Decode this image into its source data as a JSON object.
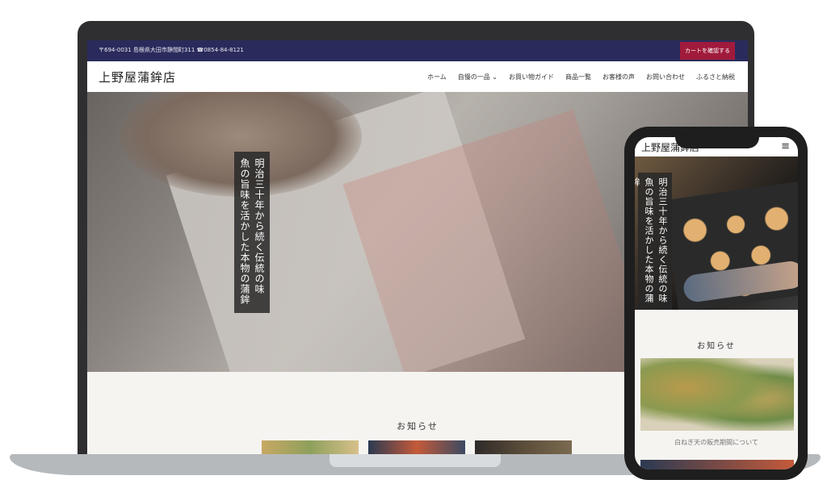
{
  "desktop": {
    "topbar": {
      "address": "〒694-0031 島根県大田市静間町311 ☎0854-84-8121",
      "cart_button": "カートを確認する"
    },
    "header": {
      "logo": "上野屋蒲鉾店",
      "nav": [
        "ホーム",
        "自慢の一品 ⌄",
        "お買い物ガイド",
        "商品一覧",
        "お客様の声",
        "お問い合わせ",
        "ふるさと納税"
      ]
    },
    "hero": {
      "tagline": "明治三十年から続く伝統の味 魚の旨味を活かした本物の蒲鉾"
    },
    "news": {
      "title": "お知らせ"
    }
  },
  "mobile": {
    "header": {
      "logo": "上野屋蒲鉾店",
      "menu_icon": "≡"
    },
    "hero": {
      "tagline": "明治三十年から続く伝統の味 魚の旨味を活かした本物の蒲鉾"
    },
    "news": {
      "title": "お知らせ",
      "items": [
        {
          "caption": "白ねぎ天の販売期間について"
        }
      ]
    }
  },
  "icons": {
    "hamburger": "hamburger-menu-icon"
  },
  "colors": {
    "topbar": "#2a2b5c",
    "cart_button": "#a01a3c",
    "tagline_box": "#282828"
  }
}
